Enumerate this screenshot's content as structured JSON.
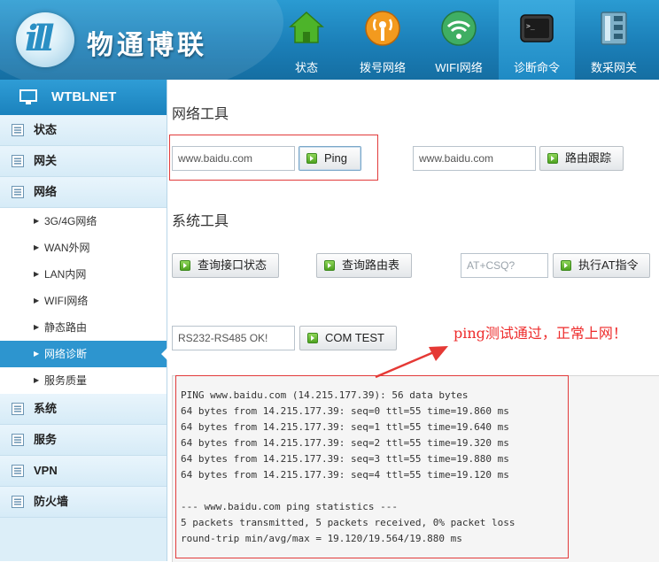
{
  "header": {
    "brand": "物通博联",
    "nav": [
      {
        "label": "状态",
        "icon": "home-icon"
      },
      {
        "label": "拨号网络",
        "icon": "broadcast-icon"
      },
      {
        "label": "WIFI网络",
        "icon": "wifi-icon"
      },
      {
        "label": "诊断命令",
        "icon": "terminal-icon",
        "active": true
      },
      {
        "label": "数采网关",
        "icon": "device-panel-icon"
      }
    ]
  },
  "sidebar": {
    "title": "WTBLNET",
    "items": [
      {
        "label": "状态"
      },
      {
        "label": "网关"
      },
      {
        "label": "网络"
      }
    ],
    "network_sub": [
      {
        "label": "3G/4G网络"
      },
      {
        "label": "WAN外网"
      },
      {
        "label": "LAN内网"
      },
      {
        "label": "WIFI网络"
      },
      {
        "label": "静态路由"
      },
      {
        "label": "网络诊断",
        "active": true
      },
      {
        "label": "服务质量"
      }
    ],
    "items_after": [
      {
        "label": "系统"
      },
      {
        "label": "服务"
      },
      {
        "label": "VPN"
      },
      {
        "label": "防火墙"
      }
    ]
  },
  "network_tools": {
    "title": "网络工具",
    "ping_input": "www.baidu.com",
    "ping_button": "Ping",
    "trace_input": "www.baidu.com",
    "trace_button": "路由跟踪"
  },
  "system_tools": {
    "title": "系统工具",
    "query_interface_button": "查询接口状态",
    "query_route_button": "查询路由表",
    "at_placeholder": "AT+CSQ?",
    "at_button": "执行AT指令",
    "com_input": "RS232-RS485 OK!",
    "com_button": "COM TEST"
  },
  "annotation": "ping测试通过，正常上网！",
  "output": [
    "PING www.baidu.com (14.215.177.39): 56 data bytes",
    "64 bytes from 14.215.177.39: seq=0 ttl=55 time=19.860 ms",
    "64 bytes from 14.215.177.39: seq=1 ttl=55 time=19.640 ms",
    "64 bytes from 14.215.177.39: seq=2 ttl=55 time=19.320 ms",
    "64 bytes from 14.215.177.39: seq=3 ttl=55 time=19.880 ms",
    "64 bytes from 14.215.177.39: seq=4 ttl=55 time=19.120 ms",
    "",
    "--- www.baidu.com ping statistics ---",
    "5 packets transmitted, 5 packets received, 0% packet loss",
    "round-trip min/avg/max = 19.120/19.564/19.880 ms"
  ],
  "colors": {
    "header_blue": "#1b7fb8",
    "sidebar_bg": "#dceef8",
    "active_blue": "#2d95cf",
    "annotation_red": "#ee2b2b"
  }
}
